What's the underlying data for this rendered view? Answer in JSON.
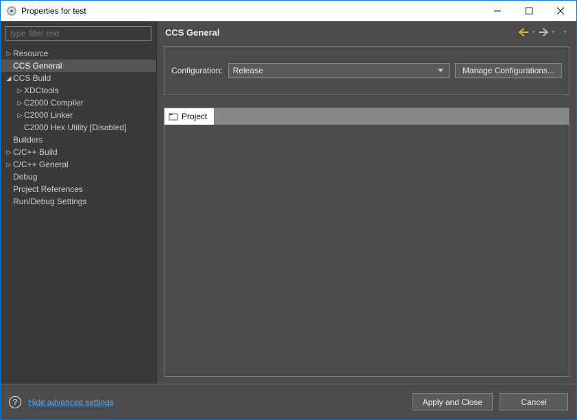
{
  "window": {
    "title": "Properties for test"
  },
  "sidebar": {
    "filter_placeholder": "type filter text",
    "items": [
      {
        "label": "Resource",
        "level": 0,
        "arrow": "right"
      },
      {
        "label": "CCS General",
        "level": 0,
        "arrow": "",
        "selected": true
      },
      {
        "label": "CCS Build",
        "level": 0,
        "arrow": "down"
      },
      {
        "label": "XDCtools",
        "level": 1,
        "arrow": "right"
      },
      {
        "label": "C2000 Compiler",
        "level": 1,
        "arrow": "right"
      },
      {
        "label": "C2000 Linker",
        "level": 1,
        "arrow": "right"
      },
      {
        "label": "C2000 Hex Utility  [Disabled]",
        "level": 1,
        "arrow": ""
      },
      {
        "label": "Builders",
        "level": 0,
        "arrow": ""
      },
      {
        "label": "C/C++ Build",
        "level": 0,
        "arrow": "right"
      },
      {
        "label": "C/C++ General",
        "level": 0,
        "arrow": "right"
      },
      {
        "label": "Debug",
        "level": 0,
        "arrow": ""
      },
      {
        "label": "Project References",
        "level": 0,
        "arrow": ""
      },
      {
        "label": "Run/Debug Settings",
        "level": 0,
        "arrow": ""
      }
    ]
  },
  "main": {
    "heading": "CCS General",
    "config_label": "Configuration:",
    "config_value": "Release",
    "manage_label": "Manage Configurations...",
    "tab_label": "Project"
  },
  "footer": {
    "link": "Hide advanced settings",
    "apply": "Apply and Close",
    "cancel": "Cancel"
  }
}
